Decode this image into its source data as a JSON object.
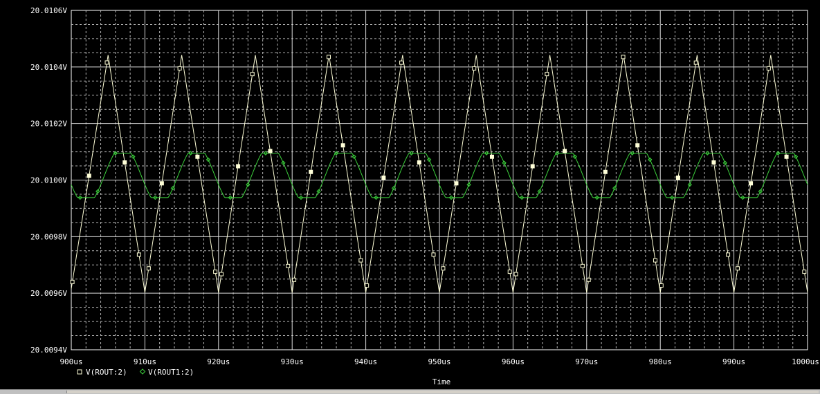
{
  "chart_data": {
    "type": "line",
    "title": "",
    "xlabel": "Time",
    "ylabel": "",
    "xlim": [
      900,
      1000
    ],
    "ylim": [
      20.0094,
      20.0106
    ],
    "x_unit": "us",
    "y_unit": "V",
    "grid": true,
    "legend_position": "bottom-left",
    "xticks": [
      900,
      910,
      920,
      930,
      940,
      950,
      960,
      970,
      980,
      990,
      1000
    ],
    "xtick_labels": [
      "900us",
      "910us",
      "920us",
      "930us",
      "940us",
      "950us",
      "960us",
      "970us",
      "980us",
      "990us",
      "1000us"
    ],
    "yticks": [
      20.0094,
      20.0096,
      20.0098,
      20.01,
      20.0102,
      20.0104,
      20.0106
    ],
    "ytick_labels": [
      "20.0094V",
      "20.0096V",
      "20.0098V",
      "20.0100V",
      "20.0102V",
      "20.0104V",
      "20.0106V"
    ],
    "series": [
      {
        "name": "V(ROUT:2)",
        "color": "#ffffd8",
        "marker": "square",
        "shape": "triangle",
        "period_us": 10,
        "first_peak_us": 905,
        "first_trough_us": 910,
        "max": 20.010442,
        "min": 20.009602,
        "start_value": 20.009615,
        "end_value": 20.009602
      },
      {
        "name": "V(ROUT1:2)",
        "color": "#3cd23c",
        "marker": "diamond",
        "shape": "clipped-sine",
        "period_us": 10,
        "first_peak_us": 907,
        "max": 20.010095,
        "min": 20.009938,
        "mean": 20.010016,
        "start_value": 20.009995,
        "end_value": 20.010005
      }
    ]
  }
}
